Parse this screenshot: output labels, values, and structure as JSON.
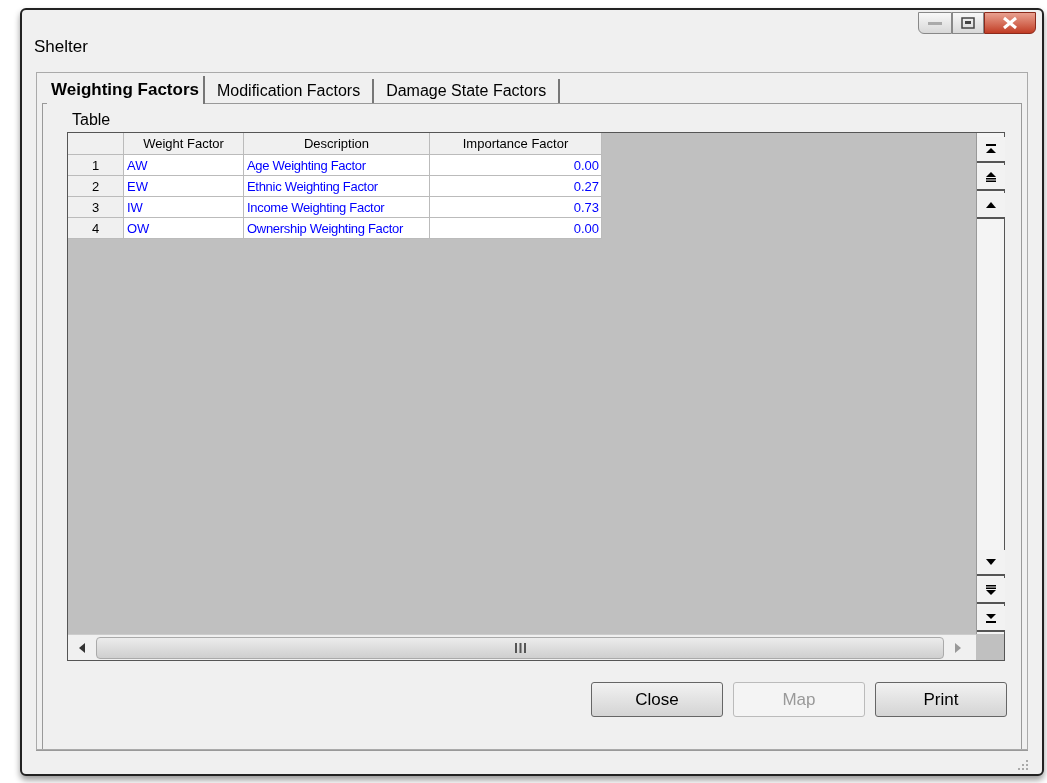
{
  "window": {
    "title": "Shelter"
  },
  "tabs": [
    {
      "label": "Weighting Factors",
      "selected": true
    },
    {
      "label": "Modification Factors",
      "selected": false
    },
    {
      "label": "Damage State Factors",
      "selected": false
    }
  ],
  "group_label": "Table",
  "table": {
    "columns": [
      "",
      "Weight Factor",
      "Description",
      "Importance Factor"
    ],
    "rows": [
      [
        "1",
        "AW",
        "Age Weighting Factor",
        "0.00"
      ],
      [
        "2",
        "EW",
        "Ethnic Weighting Factor",
        "0.27"
      ],
      [
        "3",
        "IW",
        "Income Weighting Factor",
        "0.73"
      ],
      [
        "4",
        "OW",
        "Ownership Weighting Factor",
        "0.00"
      ]
    ]
  },
  "buttons": [
    {
      "label": "Close",
      "disabled": false
    },
    {
      "label": "Map",
      "disabled": true
    },
    {
      "label": "Print",
      "disabled": false
    }
  ]
}
